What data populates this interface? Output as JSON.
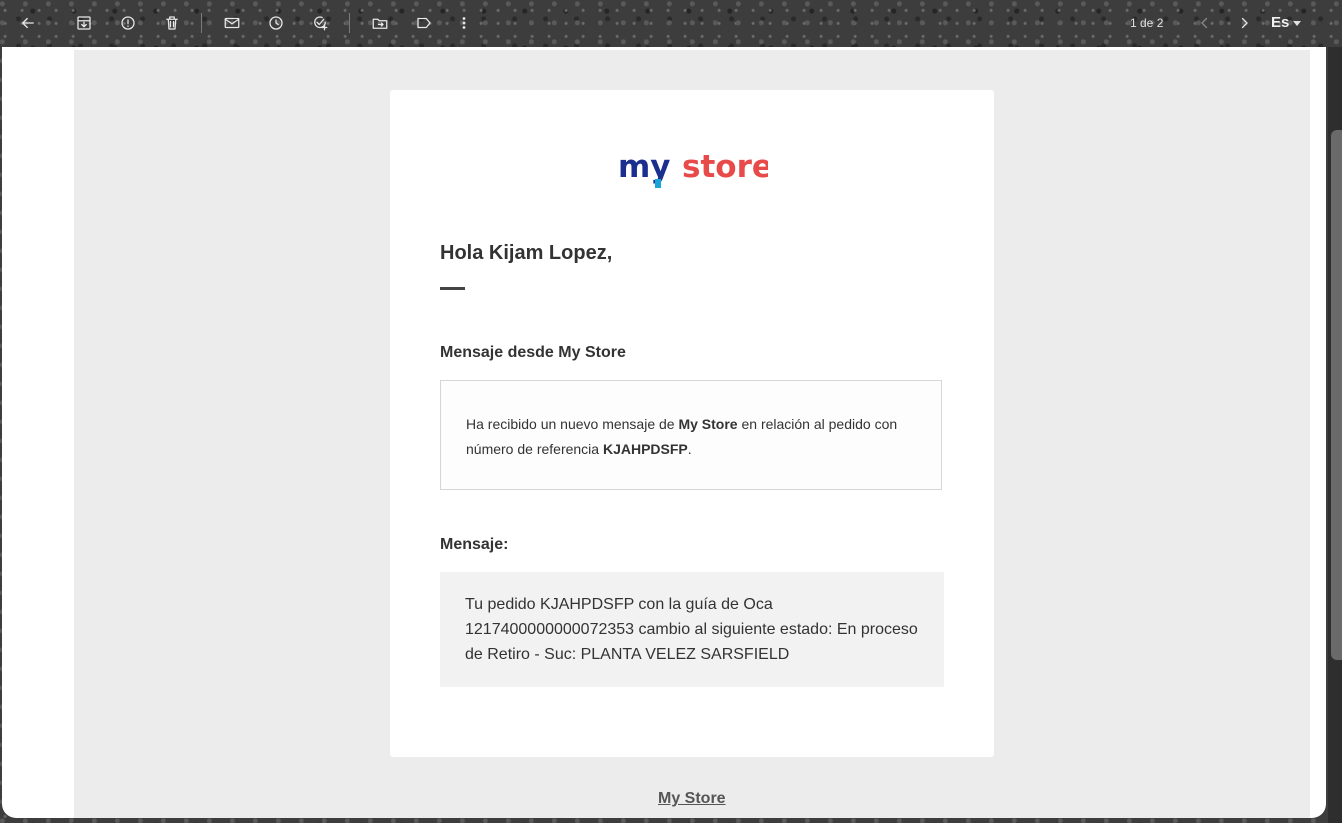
{
  "toolbar": {
    "pager": "1 de 2",
    "language": "Es",
    "icons": [
      "back-arrow-icon",
      "archive-icon",
      "report-spam-icon",
      "delete-icon",
      "mark-unread-icon",
      "snooze-icon",
      "add-task-icon",
      "move-to-icon",
      "label-icon",
      "more-vert-icon",
      "chevron-left-icon",
      "chevron-right-icon"
    ]
  },
  "email": {
    "logo_text": {
      "my": "my",
      "store": "store"
    },
    "greeting": "Hola Kijam Lopez,",
    "section1_title": "Mensaje desde My Store",
    "info": {
      "part1": "Ha recibido un nuevo mensaje de ",
      "store": "My Store",
      "part2": " en relación al pedido con número de referencia ",
      "reference": "KJAHPDSFP",
      "part3": "."
    },
    "section2_title": "Mensaje:",
    "message": "Tu pedido KJAHPDSFP con la guía de Oca 1217400000000072353 cambio al siguiente estado: En proceso de Retiro - Suc: PLANTA VELEZ SARSFIELD",
    "footer_link": "My Store"
  },
  "colors": {
    "logo_my": "#1b2f8f",
    "logo_store": "#e84a4a",
    "logo_accent": "#1aa5d8"
  }
}
